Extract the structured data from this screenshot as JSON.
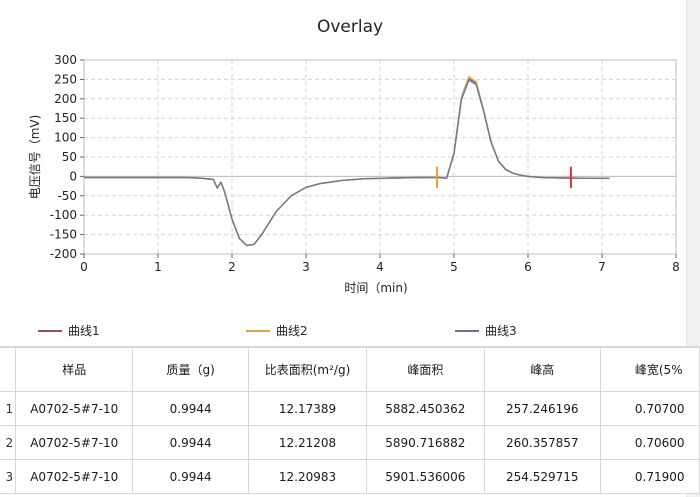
{
  "chart_data": {
    "type": "line",
    "title": "Overlay",
    "xlabel": "时间（min)",
    "ylabel": "电压信号（mV)",
    "xlim": [
      0,
      8
    ],
    "ylim": [
      -200,
      300
    ],
    "xticks": [
      "0",
      "1",
      "2",
      "3",
      "4",
      "5",
      "6",
      "7",
      "8"
    ],
    "yticks": [
      "300",
      "250",
      "200",
      "150",
      "100",
      "50",
      "0",
      "-50",
      "-100",
      "-150",
      "-200"
    ],
    "grid": true,
    "series": [
      {
        "name": "曲线1",
        "color": "#8c4d6e",
        "x": [
          0,
          0.5,
          1.0,
          1.4,
          1.6,
          1.75,
          1.8,
          1.85,
          1.9,
          2.0,
          2.1,
          2.2,
          2.3,
          2.4,
          2.5,
          2.6,
          2.8,
          3.0,
          3.2,
          3.5,
          3.8,
          4.2,
          4.5,
          4.8,
          4.9,
          5.0,
          5.1,
          5.2,
          5.3,
          5.4,
          5.5,
          5.6,
          5.7,
          5.8,
          5.9,
          6.0,
          6.2,
          6.5,
          6.8,
          7.1
        ],
        "y": [
          -3,
          -3,
          -3,
          -3,
          -5,
          -8,
          -30,
          -15,
          -40,
          -110,
          -160,
          -178,
          -175,
          -150,
          -120,
          -90,
          -50,
          -28,
          -18,
          -10,
          -6,
          -4,
          -3,
          -3,
          -5,
          60,
          200,
          252,
          240,
          170,
          90,
          40,
          18,
          8,
          3,
          0,
          -3,
          -4,
          -5,
          -5
        ]
      },
      {
        "name": "曲线2",
        "color": "#d0a94a",
        "x": [
          0,
          0.5,
          1.0,
          1.4,
          1.6,
          1.75,
          1.8,
          1.85,
          1.9,
          2.0,
          2.1,
          2.2,
          2.3,
          2.4,
          2.5,
          2.6,
          2.8,
          3.0,
          3.2,
          3.5,
          3.8,
          4.2,
          4.5,
          4.8,
          4.9,
          5.0,
          5.1,
          5.2,
          5.3,
          5.4,
          5.5,
          5.6,
          5.7,
          5.8,
          5.9,
          6.0,
          6.2,
          6.5,
          6.8,
          7.1
        ],
        "y": [
          -3,
          -3,
          -3,
          -3,
          -5,
          -8,
          -30,
          -15,
          -40,
          -110,
          -160,
          -178,
          -175,
          -150,
          -120,
          -90,
          -50,
          -28,
          -18,
          -10,
          -6,
          -4,
          -3,
          -3,
          -5,
          62,
          205,
          258,
          244,
          172,
          91,
          40,
          18,
          8,
          3,
          0,
          -3,
          -4,
          -5,
          -5
        ]
      },
      {
        "name": "曲线3",
        "color": "#6f6f8c",
        "x": [
          0,
          0.5,
          1.0,
          1.4,
          1.6,
          1.75,
          1.8,
          1.85,
          1.9,
          2.0,
          2.1,
          2.2,
          2.3,
          2.4,
          2.5,
          2.6,
          2.8,
          3.0,
          3.2,
          3.5,
          3.8,
          4.2,
          4.5,
          4.8,
          4.9,
          5.0,
          5.1,
          5.2,
          5.3,
          5.4,
          5.5,
          5.6,
          5.7,
          5.8,
          5.9,
          6.0,
          6.2,
          6.5,
          6.8,
          7.1
        ],
        "y": [
          -3,
          -3,
          -3,
          -3,
          -5,
          -8,
          -30,
          -15,
          -40,
          -110,
          -160,
          -178,
          -175,
          -150,
          -120,
          -90,
          -50,
          -28,
          -18,
          -10,
          -6,
          -4,
          -3,
          -3,
          -5,
          58,
          198,
          248,
          236,
          168,
          88,
          39,
          17,
          8,
          3,
          0,
          -3,
          -4,
          -5,
          -5
        ]
      }
    ],
    "markers": [
      {
        "x": 4.77,
        "y_from": -30,
        "y_to": 25,
        "color": "#f0a030"
      },
      {
        "x": 6.58,
        "y_from": -30,
        "y_to": 25,
        "color": "#e03040"
      }
    ]
  },
  "legend": {
    "items": [
      {
        "label": "曲线1",
        "color": "#8c4d6e"
      },
      {
        "label": "曲线2",
        "color": "#d0a94a"
      },
      {
        "label": "曲线3",
        "color": "#6f6f8c"
      }
    ]
  },
  "table": {
    "columns": [
      "样品",
      "质量（g)",
      "比表面积(m²/g)",
      "峰面积",
      "峰高",
      "峰宽(5%"
    ],
    "rows": [
      {
        "num": "1",
        "cells": [
          "A0702-5#7-10",
          "0.9944",
          "12.17389",
          "5882.450362",
          "257.246196",
          "0.70700"
        ]
      },
      {
        "num": "2",
        "cells": [
          "A0702-5#7-10",
          "0.9944",
          "12.21208",
          "5890.716882",
          "260.357857",
          "0.70600"
        ]
      },
      {
        "num": "3",
        "cells": [
          "A0702-5#7-10",
          "0.9944",
          "12.20983",
          "5901.536006",
          "254.529715",
          "0.71900"
        ]
      }
    ]
  }
}
